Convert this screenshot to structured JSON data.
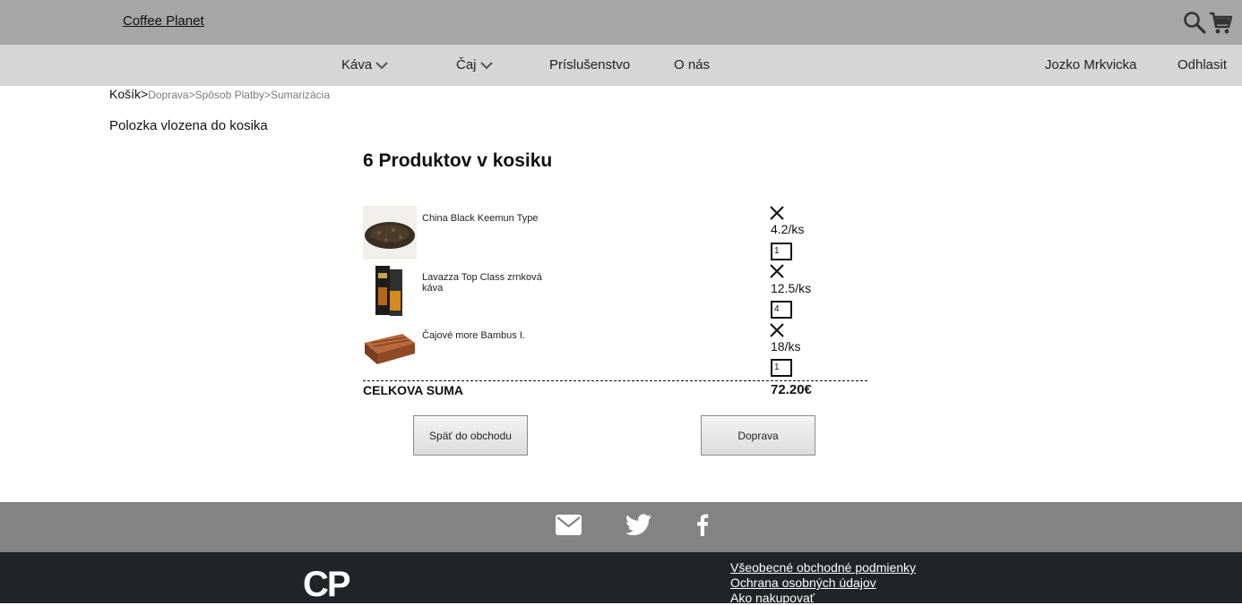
{
  "header": {
    "brand": "Coffee Planet",
    "search_icon": "search-icon",
    "cart_icon": "cart-icon"
  },
  "nav": {
    "kava": "Káva",
    "caj": "Čaj",
    "prislusenstvo": "Príslušenstvo",
    "o_nas": "O nás",
    "user": "Jozko Mrkvicka",
    "logout": "Odhlasit"
  },
  "breadcrumb": {
    "current": "Košík",
    "sep": ">",
    "step2": "Doprava",
    "step3": "Spôsob Platby",
    "step4": "Sumarizácia"
  },
  "notice": "Polozka vlozena do kosika",
  "cart": {
    "heading": "6 Produktov v kosiku",
    "items": [
      {
        "name": "China Black Keemun Type",
        "price": "4.2/ks",
        "qty": "1"
      },
      {
        "name": "Lavazza Top Class zrnková káva",
        "price": "12.5/ks",
        "qty": "4"
      },
      {
        "name": "Čajové more Bambus I.",
        "price": "18/ks",
        "qty": "1"
      }
    ],
    "total_label": "CELKOVA SUMA",
    "total_value": "72.20€"
  },
  "buttons": {
    "back": "Späť do obchodu",
    "next": "Doprava"
  },
  "footer": {
    "icons": [
      "mail-icon",
      "twitter-icon",
      "facebook-icon"
    ],
    "logo": "CP",
    "links": [
      "Všeobecné obchodné podmienky",
      "Ochrana osobných údajov",
      "Ako nakupovať"
    ]
  },
  "colors": {
    "topbar": "#a6a6a6",
    "navbar": "#d6d6d6",
    "social_bar": "#838383",
    "footer": "#222326"
  }
}
